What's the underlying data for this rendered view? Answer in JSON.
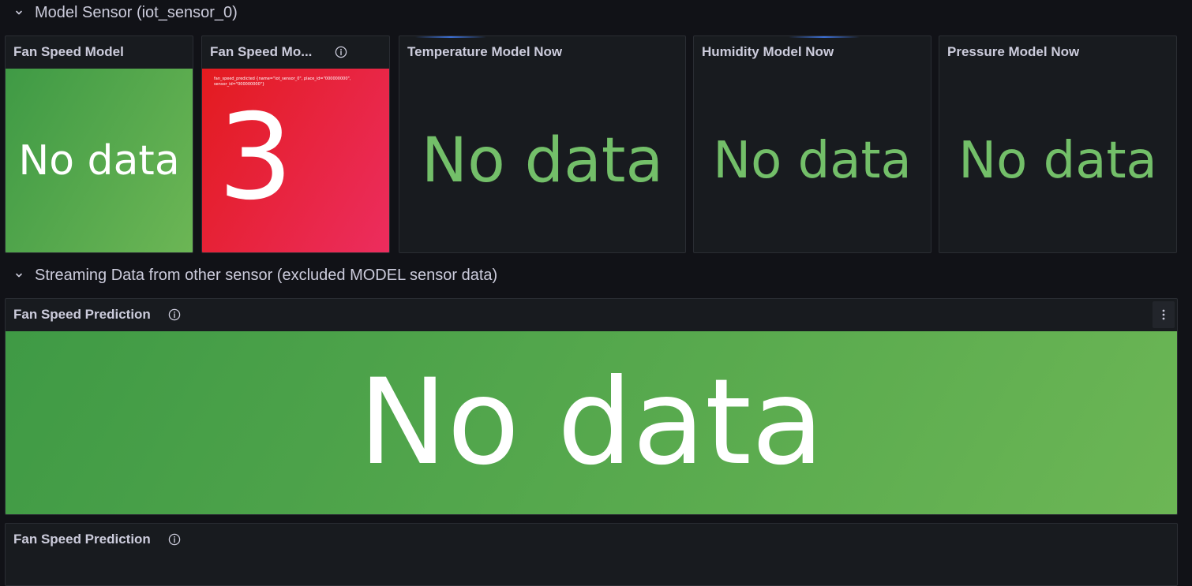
{
  "rows": [
    {
      "title": "Model Sensor (iot_sensor_0)"
    },
    {
      "title": "Streaming Data from other sensor (excluded MODEL sensor data)"
    }
  ],
  "panels": {
    "fan_speed_model": {
      "title": "Fan Speed Model",
      "value": "No data"
    },
    "fan_speed_model_2": {
      "title": "Fan Speed Mo...",
      "series_label": "fan_speed_predicted {name=\"iot_sensor_0\", place_id=\"000000000\", sensor_id=\"000000000\"}",
      "value": "3"
    },
    "temperature_model_now": {
      "title": "Temperature Model Now",
      "value": "No data"
    },
    "humidity_model_now": {
      "title": "Humidity Model Now",
      "value": "No data"
    },
    "pressure_model_now": {
      "title": "Pressure Model Now",
      "value": "No data"
    },
    "fan_speed_prediction": {
      "title": "Fan Speed Prediction",
      "value": "No data"
    },
    "fan_speed_prediction_2": {
      "title": "Fan Speed Prediction"
    }
  },
  "colors": {
    "background": "#111217",
    "panel": "#181b1f",
    "ok_green": "#73bf69",
    "alert_red": "#e31b1f",
    "text": "#ccccdc"
  },
  "icons": {
    "row_toggle": "chevron-down-icon",
    "info": "info-icon",
    "menu": "kebab-menu-icon"
  }
}
